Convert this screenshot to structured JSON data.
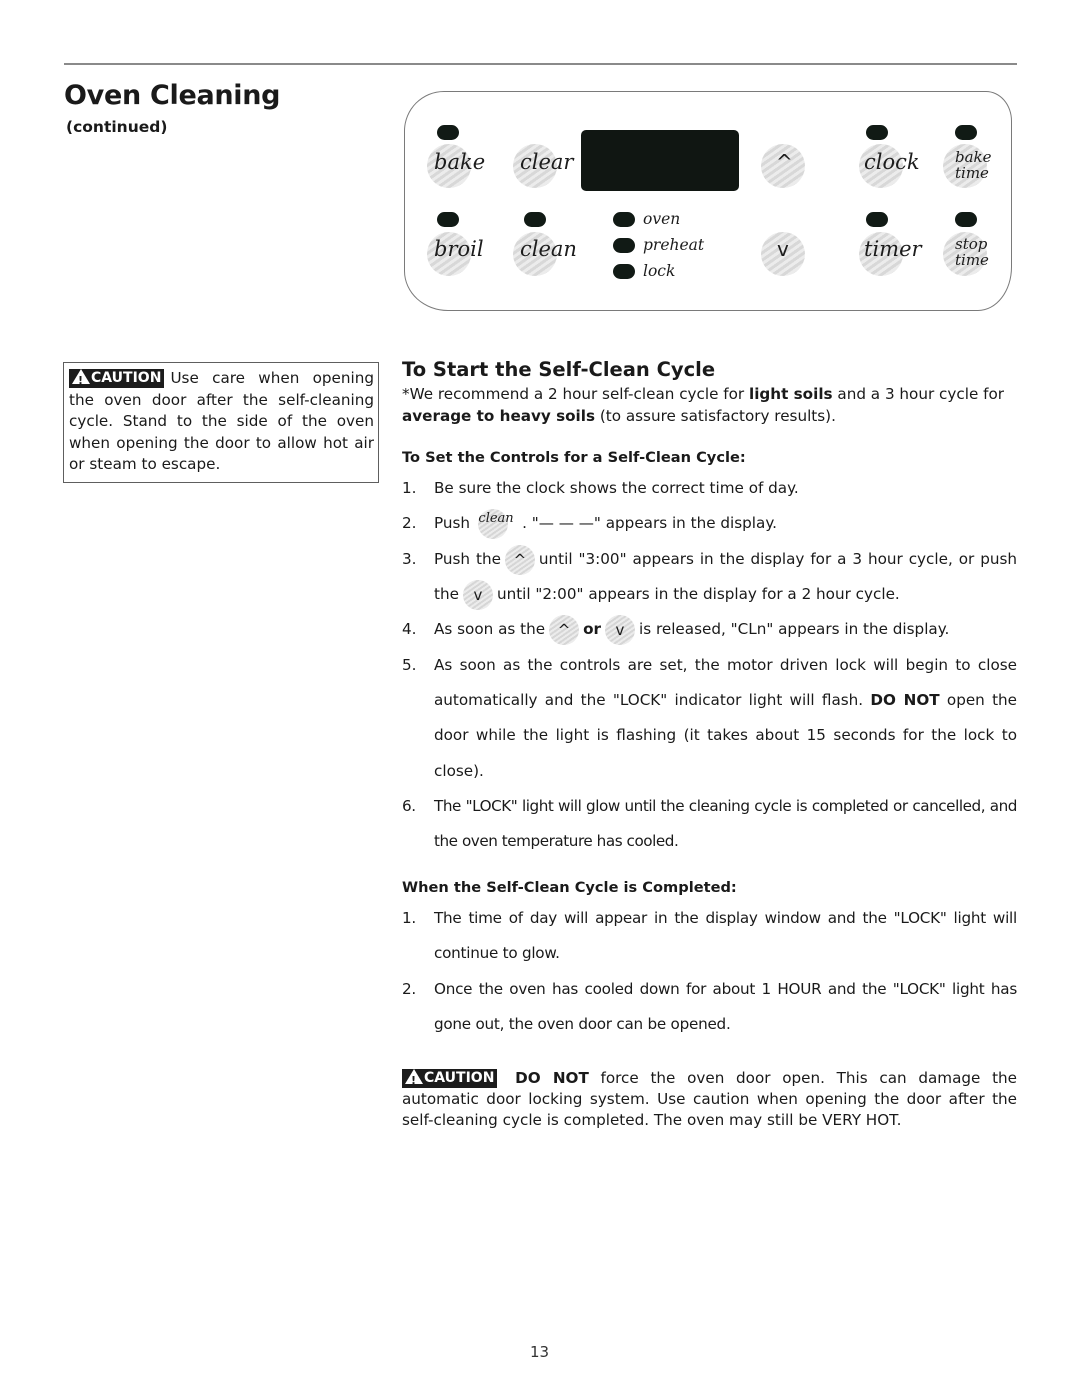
{
  "header": {
    "title": "Oven Cleaning",
    "subtitle": "(continued)"
  },
  "control_panel": {
    "buttons": {
      "bake": "bake",
      "clear": "clear",
      "up": "^",
      "clock": "clock",
      "bake_time_1": "bake",
      "bake_time_2": "time",
      "broil": "broil",
      "clean": "clean",
      "down": "v",
      "timer": "timer",
      "stop_time_1": "stop",
      "stop_time_2": "time"
    },
    "indicators": [
      "oven",
      "preheat",
      "lock"
    ]
  },
  "caution_left": {
    "badge": "CAUTION",
    "text": "Use care when opening the oven door after the self-cleaning cycle. Stand to the side of the oven when opening the door to allow hot air or steam to escape."
  },
  "section": {
    "title": "To Start the Self-Clean Cycle",
    "intro_1": "*We recommend a 2 hour self-clean cycle for ",
    "intro_bold_1": "light soils",
    "intro_2": " and a 3 hour cycle for ",
    "intro_bold_2": "average to heavy soils",
    "intro_3": " (to assure satisfactory results)."
  },
  "set_controls": {
    "heading": "To Set the Controls for a Self-Clean Cycle:",
    "steps": [
      {
        "num": "1.",
        "text": "Be sure the clock shows the correct time of day."
      },
      {
        "num": "2.",
        "pre": "Push",
        "icon": "clean",
        "post": ". \"— — —\" appears in the display."
      },
      {
        "num": "3.",
        "pre": "Push the",
        "icon_up": "^",
        "mid": "until \"3:00\" appears in the display for a 3 hour cycle, or push the",
        "icon_down": "v",
        "post": "until \"2:00\" appears in the display for a 2 hour cycle."
      },
      {
        "num": "4.",
        "pre": "As soon as the",
        "or": "or",
        "post": "is released, \"CLn\" appears in the display."
      },
      {
        "num": "5.",
        "pre": "As soon as the controls are set, the motor driven lock will begin to close automatically and the \"LOCK\" indicator light will flash.",
        "bold": "DO NOT",
        "post": "open the door while the light is flashing (it takes about 15 seconds for the lock to close)."
      },
      {
        "num": "6.",
        "text": "The \"LOCK\" light will glow until the cleaning cycle is completed or cancelled, and the oven temperature has cooled."
      }
    ]
  },
  "completed": {
    "heading": "When the Self-Clean Cycle is Completed:",
    "steps": [
      {
        "num": "1.",
        "text": "The time of day will appear in the display window and the \"LOCK\" light will continue to glow."
      },
      {
        "num": "2.",
        "text": "Once the oven has cooled down for about 1 HOUR and the \"LOCK\" light has gone out, the oven door can be opened."
      }
    ]
  },
  "caution_bottom": {
    "badge": "CAUTION",
    "bold": "DO NOT",
    "text": " force the oven door open. This can damage the automatic door locking system. Use caution when opening the door after the self-cleaning cycle is completed. The oven may still be VERY HOT."
  },
  "footer": {
    "page_number": "13"
  }
}
